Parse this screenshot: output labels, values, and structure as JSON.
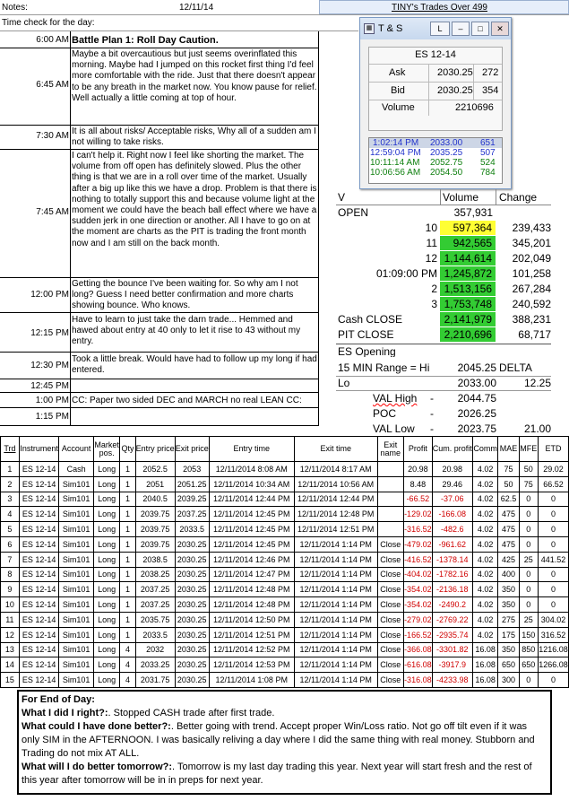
{
  "header": {
    "notes_label": "Notes:",
    "date": "12/11/14",
    "tab_title": "TINY's Trades Over 499",
    "time_check_label": "Time check for the day:"
  },
  "notes": [
    {
      "time": "6:00 AM",
      "text": "Battle Plan 1: Roll Day Caution."
    },
    {
      "time": "6:45 AM",
      "text": "Maybe a bit overcautious but just seems overinflated this morning.  Maybe had I jumped on this rocket first thing I'd feel more comfortable with the ride.  Just that there doesn't appear to be any breath in the market now.  You know pause for relief.  Well actually a little coming at top of hour."
    },
    {
      "time": "7:30 AM",
      "text": "It is all about risks/ Acceptable risks, Why all of a sudden am I not willing to take risks."
    },
    {
      "time": "7:45 AM",
      "text": "I can't help it.  Right now I feel like shorting the market.  The volume from off open has definitely slowed.  Plus the other thing is that we are in a roll over time of the market.  Usually after a big up like this we have a drop.  Problem is that there is nothing to totally support this and because volume light at the moment we could have the beach ball effect where we have a sudden jerk in one direction or another.  All I have to go on at the moment are charts as the PIT is trading the front month now and I am still on the back month."
    },
    {
      "time": "12:00 PM",
      "text": "Getting the bounce I've been waiting for.  So why am I not long?  Guess I need better confirmation and more charts showing bounce.  Who knows."
    },
    {
      "time": "12:15 PM",
      "text": "Have to learn to just take the darn trade... Hemmed and hawed about entry at 40 only to let it rise to 43 without my entry."
    },
    {
      "time": "12:30 PM",
      "text": "Took a little break.  Would have had to follow up my long if had entered."
    },
    {
      "time": "12:45 PM",
      "text": ""
    },
    {
      "time": "1:00 PM",
      "text": "CC: Paper two sided DEC and MARCH no real LEAN CC:"
    },
    {
      "time": "1:15 PM",
      "text": ""
    }
  ],
  "ts_window": {
    "title": "T & S",
    "btn_l": "L",
    "btn_min": "–",
    "btn_max": "□",
    "btn_close": "✕",
    "symbol": "ES 12-14",
    "ask_label": "Ask",
    "ask_price": "2030.25",
    "ask_size": "272",
    "bid_label": "Bid",
    "bid_price": "2030.25",
    "bid_size": "354",
    "volume_label": "Volume",
    "volume": "2210696",
    "prints": [
      {
        "time": "1:02:14 PM",
        "price": "2033.00",
        "size": "651"
      },
      {
        "time": "12:59:04 PM",
        "price": "2035.25",
        "size": "507"
      },
      {
        "time": "10:11:14 AM",
        "price": "2052.75",
        "size": "524"
      },
      {
        "time": "10:06:56 AM",
        "price": "2054.50",
        "size": "784"
      }
    ]
  },
  "stats": {
    "v_label": "V",
    "volume_header": "Volume",
    "change_header": "Change",
    "open_label": "OPEN",
    "open_volume": "357,931",
    "rows": [
      {
        "label": "10",
        "volume": "597,364",
        "change": "239,433",
        "color": "yellow"
      },
      {
        "label": "11",
        "volume": "942,565",
        "change": "345,201",
        "color": "green"
      },
      {
        "label": "12",
        "volume": "1,144,614",
        "change": "202,049",
        "color": "green"
      },
      {
        "label": "01:09:00 PM",
        "volume": "1,245,872",
        "change": "101,258",
        "color": "green"
      },
      {
        "label": "2",
        "volume": "1,513,156",
        "change": "267,284",
        "color": "green"
      },
      {
        "label": "3",
        "volume": "1,753,748",
        "change": "240,592",
        "color": "green"
      }
    ],
    "cash_close_label": "Cash CLOSE",
    "cash_close": "2,141,979",
    "cash_close_change": "388,231",
    "pit_close_label": "PIT CLOSE",
    "pit_close": "2,210,696",
    "pit_close_change": "68,717",
    "es_opening_label": "ES Opening",
    "range_label": "15 MIN Range = Hi",
    "range_hi": "2045.25",
    "delta_label": "DELTA",
    "lo_label": "Lo",
    "range_lo": "2033.00",
    "delta": "12.25",
    "val_high_label": "VAL High",
    "val_high_dash": "-",
    "val_high": "2044.75",
    "poc_label": "POC",
    "poc_dash": "-",
    "poc": "2026.25",
    "val_low_label": "VAL Low",
    "val_low_dash": "-",
    "val_low": "2023.75",
    "val_range": "21.00"
  },
  "trades": {
    "headers": [
      "Trd",
      "Instrument",
      "Account",
      "Market pos.",
      "Qty",
      "Entry price",
      "Exit price",
      "Entry time",
      "Exit time",
      "Exit name",
      "Profit",
      "Cum. profit",
      "Comm",
      "MAE",
      "MFE",
      "ETD"
    ],
    "rows": [
      [
        "1",
        "ES 12-14",
        "Cash",
        "Long",
        "1",
        "2052.5",
        "2053",
        "12/11/2014 8:08 AM",
        "12/11/2014 8:17 AM",
        "",
        "20.98",
        "20.98",
        "4.02",
        "75",
        "50",
        "29.02"
      ],
      [
        "2",
        "ES 12-14",
        "Sim101",
        "Long",
        "1",
        "2051",
        "2051.25",
        "12/11/2014 10:34 AM",
        "12/11/2014 10:56 AM",
        "",
        "8.48",
        "29.46",
        "4.02",
        "50",
        "75",
        "66.52"
      ],
      [
        "3",
        "ES 12-14",
        "Sim101",
        "Long",
        "1",
        "2040.5",
        "2039.25",
        "12/11/2014 12:44 PM",
        "12/11/2014 12:44 PM",
        "",
        "-66.52",
        "-37.06",
        "4.02",
        "62.5",
        "0",
        "0"
      ],
      [
        "4",
        "ES 12-14",
        "Sim101",
        "Long",
        "1",
        "2039.75",
        "2037.25",
        "12/11/2014 12:45 PM",
        "12/11/2014 12:48 PM",
        "",
        "-129.02",
        "-166.08",
        "4.02",
        "475",
        "0",
        "0"
      ],
      [
        "5",
        "ES 12-14",
        "Sim101",
        "Long",
        "1",
        "2039.75",
        "2033.5",
        "12/11/2014 12:45 PM",
        "12/11/2014 12:51 PM",
        "",
        "-316.52",
        "-482.6",
        "4.02",
        "475",
        "0",
        "0"
      ],
      [
        "6",
        "ES 12-14",
        "Sim101",
        "Long",
        "1",
        "2039.75",
        "2030.25",
        "12/11/2014 12:45 PM",
        "12/11/2014 1:14 PM",
        "Close",
        "-479.02",
        "-961.62",
        "4.02",
        "475",
        "0",
        "0"
      ],
      [
        "7",
        "ES 12-14",
        "Sim101",
        "Long",
        "1",
        "2038.5",
        "2030.25",
        "12/11/2014 12:46 PM",
        "12/11/2014 1:14 PM",
        "Close",
        "-416.52",
        "-1378.14",
        "4.02",
        "425",
        "25",
        "441.52"
      ],
      [
        "8",
        "ES 12-14",
        "Sim101",
        "Long",
        "1",
        "2038.25",
        "2030.25",
        "12/11/2014 12:47 PM",
        "12/11/2014 1:14 PM",
        "Close",
        "-404.02",
        "-1782.16",
        "4.02",
        "400",
        "0",
        "0"
      ],
      [
        "9",
        "ES 12-14",
        "Sim101",
        "Long",
        "1",
        "2037.25",
        "2030.25",
        "12/11/2014 12:48 PM",
        "12/11/2014 1:14 PM",
        "Close",
        "-354.02",
        "-2136.18",
        "4.02",
        "350",
        "0",
        "0"
      ],
      [
        "10",
        "ES 12-14",
        "Sim101",
        "Long",
        "1",
        "2037.25",
        "2030.25",
        "12/11/2014 12:48 PM",
        "12/11/2014 1:14 PM",
        "Close",
        "-354.02",
        "-2490.2",
        "4.02",
        "350",
        "0",
        "0"
      ],
      [
        "11",
        "ES 12-14",
        "Sim101",
        "Long",
        "1",
        "2035.75",
        "2030.25",
        "12/11/2014 12:50 PM",
        "12/11/2014 1:14 PM",
        "Close",
        "-279.02",
        "-2769.22",
        "4.02",
        "275",
        "25",
        "304.02"
      ],
      [
        "12",
        "ES 12-14",
        "Sim101",
        "Long",
        "1",
        "2033.5",
        "2030.25",
        "12/11/2014 12:51 PM",
        "12/11/2014 1:14 PM",
        "Close",
        "-166.52",
        "-2935.74",
        "4.02",
        "175",
        "150",
        "316.52"
      ],
      [
        "13",
        "ES 12-14",
        "Sim101",
        "Long",
        "4",
        "2032",
        "2030.25",
        "12/11/2014 12:52 PM",
        "12/11/2014 1:14 PM",
        "Close",
        "-366.08",
        "-3301.82",
        "16.08",
        "350",
        "850",
        "1216.08"
      ],
      [
        "14",
        "ES 12-14",
        "Sim101",
        "Long",
        "4",
        "2033.25",
        "2030.25",
        "12/11/2014 12:53 PM",
        "12/11/2014 1:14 PM",
        "Close",
        "-616.08",
        "-3917.9",
        "16.08",
        "650",
        "650",
        "1266.08"
      ],
      [
        "15",
        "ES 12-14",
        "Sim101",
        "Long",
        "4",
        "2031.75",
        "2030.25",
        "12/11/2014 1:08 PM",
        "12/11/2014 1:14 PM",
        "Close",
        "-316.08",
        "-4233.98",
        "16.08",
        "300",
        "0",
        "0"
      ]
    ]
  },
  "eod": {
    "title": "For End of Day:",
    "q1": "What I did I right?:",
    "a1": ".  Stopped CASH trade after first trade.",
    "q2": "What could I have done better?:",
    "a2": ".  Better going with trend.  Accept proper Win/Loss ratio.  Not go off tilt even if it was only SIM in the AFTERNOON.  I was basically reliving a day where I did the same thing with real money.  Stubborn and Trading do not mix AT ALL.",
    "q3": "What will I do better tomorrow?:",
    "a3": ".  Tomorrow is my last day trading this year.  Next year will start fresh and the rest of this year after tomorrow will be in in preps for next year."
  }
}
